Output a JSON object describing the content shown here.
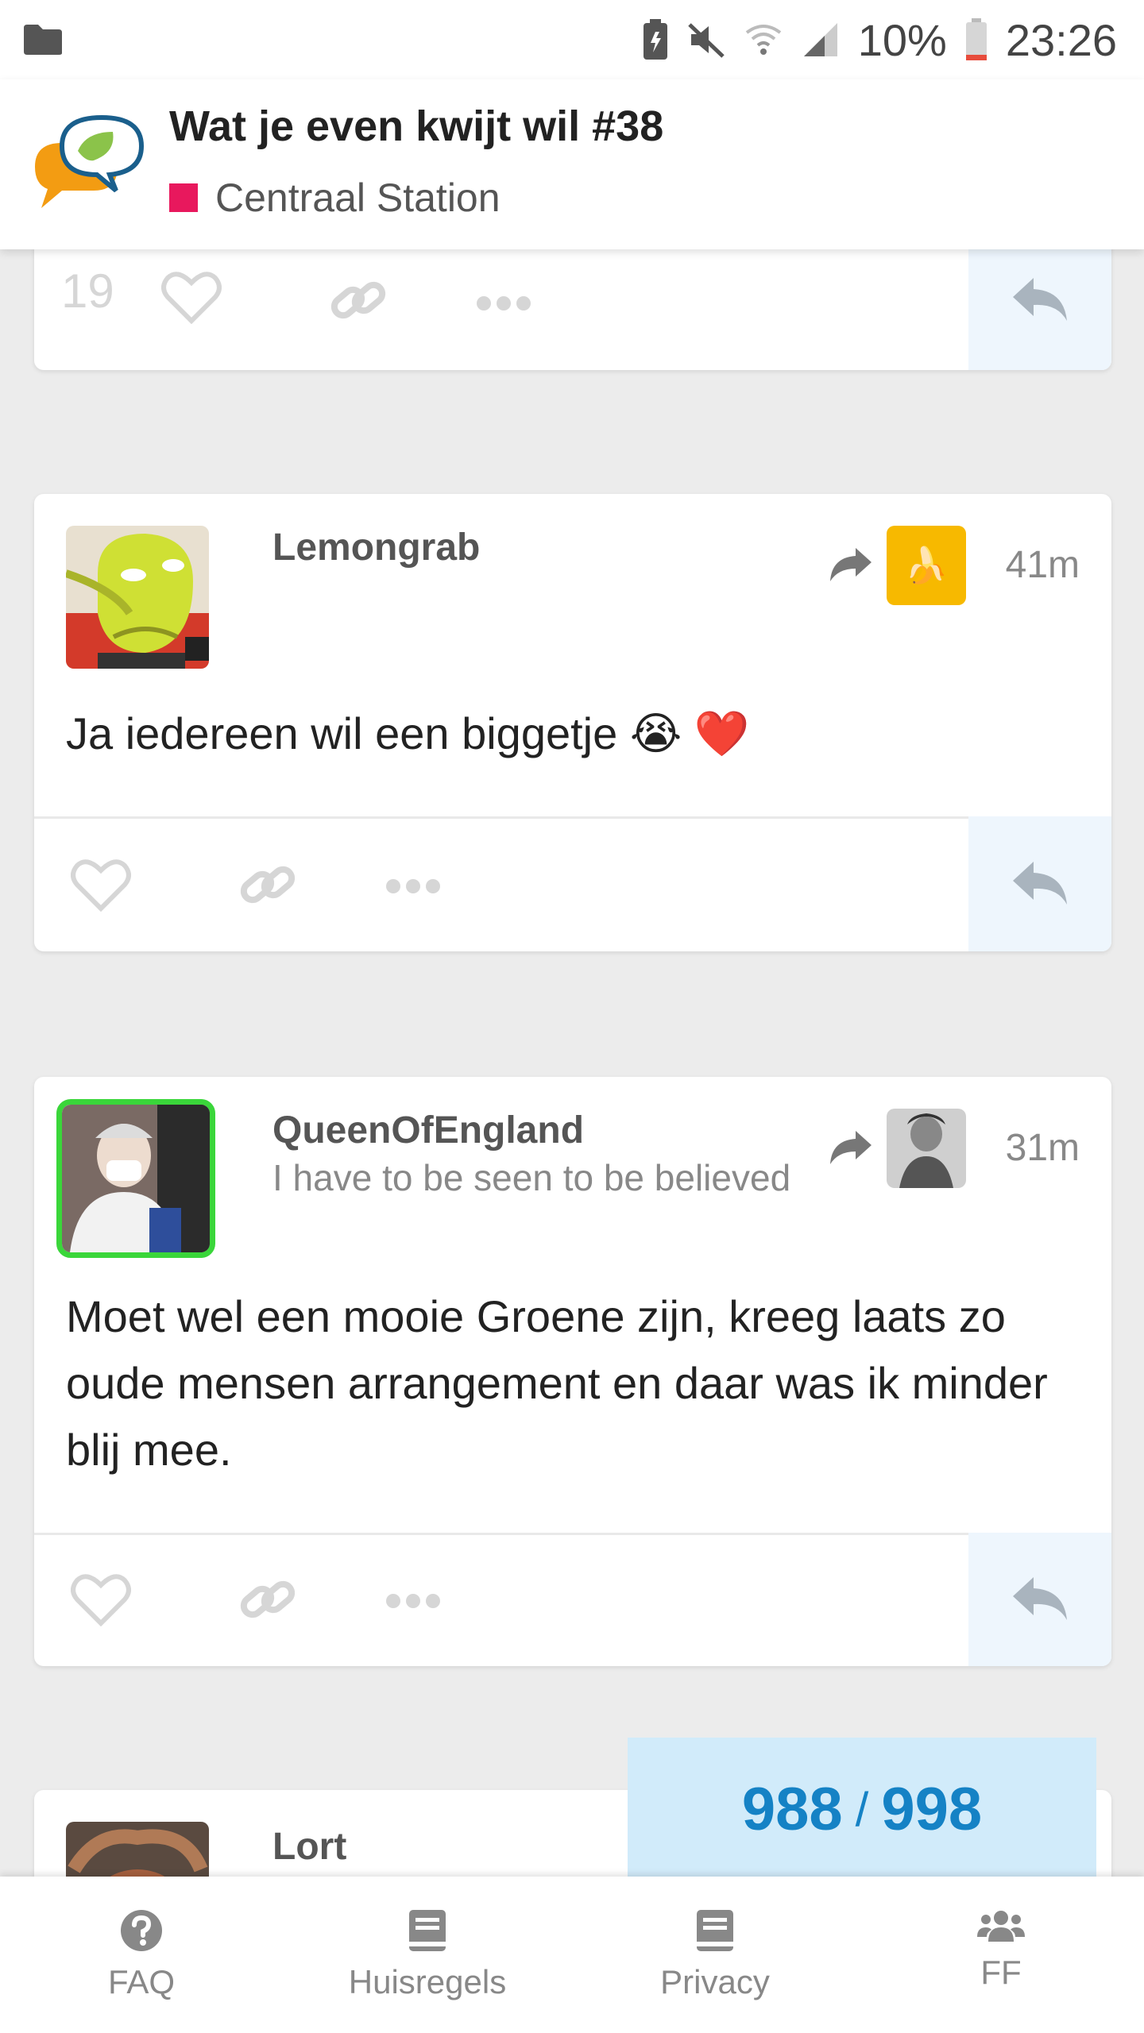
{
  "status_bar": {
    "battery_percent": "10%",
    "time": "23:26",
    "icons": [
      "folder-icon",
      "battery-saver-icon",
      "mute-icon",
      "wifi-icon",
      "signal-icon",
      "battery-icon"
    ]
  },
  "header": {
    "title": "Wat je even kwijt wil #38",
    "category": "Centraal Station",
    "category_color": "#e8185d"
  },
  "posts": [
    {
      "like_count": "19"
    },
    {
      "username": "Lemongrab",
      "time": "41m",
      "body": "Ja iedereen wil een biggetje 😭 ❤️",
      "reply_to_badge": "🍌"
    },
    {
      "username": "QueenOfEngland",
      "user_title": "I have to be seen to be believed",
      "time": "31m",
      "body": "Moet wel een mooie Groene zijn, kreeg laats zo oude mensen arrangement en daar was ik minder blij mee."
    },
    {
      "username": "Lort"
    }
  ],
  "progress": {
    "current": "988",
    "separator": "/",
    "total": "998"
  },
  "bottom_nav": [
    {
      "label": "FAQ",
      "icon": "question-circle-icon"
    },
    {
      "label": "Huisregels",
      "icon": "book-icon"
    },
    {
      "label": "Privacy",
      "icon": "book-icon"
    },
    {
      "label": "FF",
      "icon": "users-icon"
    }
  ],
  "colors": {
    "accent": "#1582c5",
    "progress_bg": "#d1ebfa",
    "reply_bg": "#eef6fd",
    "online_ring": "#3ad63a"
  }
}
